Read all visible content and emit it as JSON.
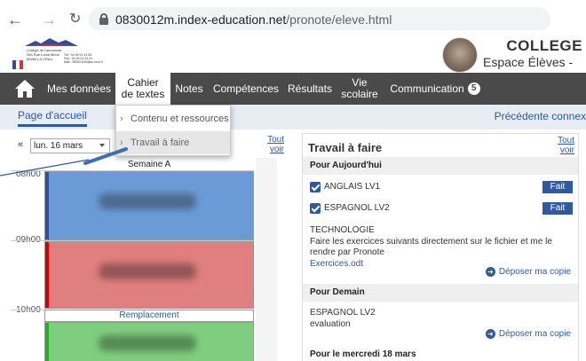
{
  "browser": {
    "url_host": "0830012m.index-education.net",
    "url_path": "/pronote/eleve.html"
  },
  "school": {
    "logo_lines": [
      "Collège de l'annonciat",
      "264 Rue Louis Mério",
      "83260 LA CRAU"
    ],
    "logo_contact": [
      "Tél : 04 94 01 41 00",
      "Fax : 04 94 01 41 01",
      "Mail : 0830012m@ac-nice.fr"
    ],
    "college_name": "COLLEGE",
    "espace": "Espace Élèves -"
  },
  "nav": {
    "items": [
      {
        "label": "Mes données"
      },
      {
        "label": "Cahier de textes",
        "line1": "Cahier",
        "line2": "de textes"
      },
      {
        "label": "Notes"
      },
      {
        "label": "Compétences"
      },
      {
        "label": "Résultats"
      },
      {
        "label": "Vie scolaire",
        "line1": "Vie",
        "line2": "scolaire"
      },
      {
        "label": "Communication"
      }
    ],
    "communication_badge": "5"
  },
  "subnav": {
    "tab": "Page d'accueil",
    "previous_connection": "Précédente connex"
  },
  "dropdown": {
    "items": [
      "Contenu et ressources",
      "Travail à faire"
    ]
  },
  "calendar": {
    "date": "lun. 16 mars",
    "tout_voir_1": "Tout",
    "tout_voir_2": "voir",
    "week": "Semaine A",
    "times": [
      "08h00",
      "09h00",
      "10h00"
    ],
    "remplacement": "Remplacement",
    "colors": {
      "blue": "#6b9bd6",
      "red": "#e07f7f",
      "green": "#7fce7f"
    }
  },
  "homework": {
    "title": "Travail à faire",
    "tout_voir_1": "Tout",
    "tout_voir_2": "voir",
    "today": "Pour Aujourd'hui",
    "tasks_done": [
      {
        "subject": "ANGLAIS LV1",
        "status": "Fait"
      },
      {
        "subject": "ESPAGNOL LV2",
        "status": "Fait"
      }
    ],
    "techno": {
      "subject": "TECHNOLOGIE",
      "line1": "Faire les exercices suivants directement sur le fichier et me le",
      "line2": "rendre par Pronote",
      "file": "Exercices.odt",
      "deposit": "Déposer ma copie"
    },
    "tomorrow": "Pour Demain",
    "espagnol": {
      "subject": "ESPAGNOL LV2",
      "text": "evaluation",
      "deposit": "Déposer ma copie"
    },
    "wednesday": "Pour le mercredi 18 mars"
  }
}
